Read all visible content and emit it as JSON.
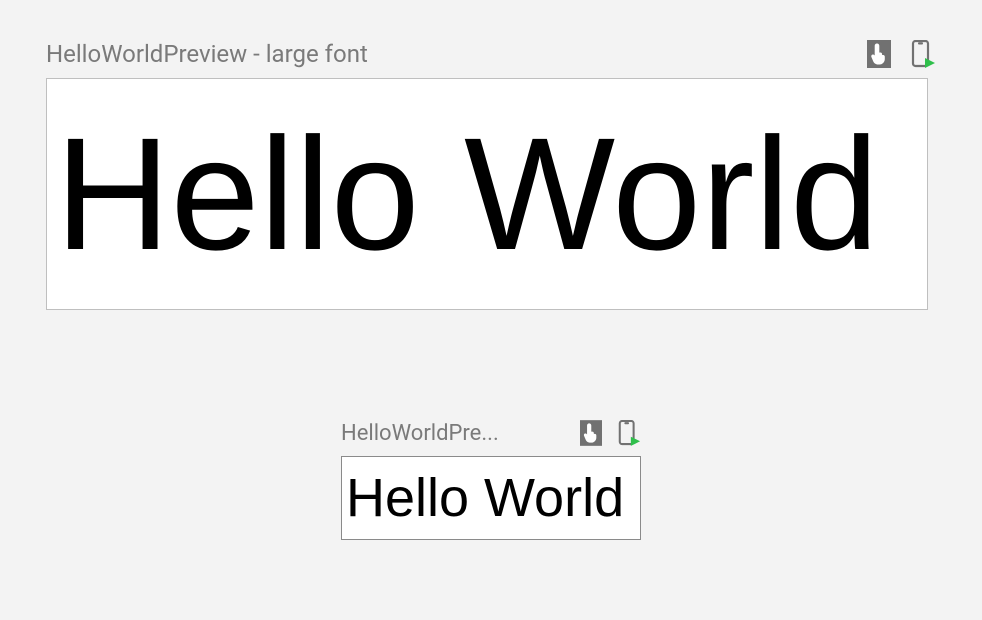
{
  "previews": [
    {
      "title": "HelloWorldPreview - large font",
      "content": "Hello World"
    },
    {
      "title": "HelloWorldPre...",
      "content": "Hello World"
    }
  ],
  "colors": {
    "background": "#f3f3f3",
    "title": "#7a7a7a",
    "canvas_border": "#bfbfbf",
    "icon_bg": "#717171",
    "icon_fg": "#ffffff",
    "accent_green": "#2fbf4b"
  }
}
